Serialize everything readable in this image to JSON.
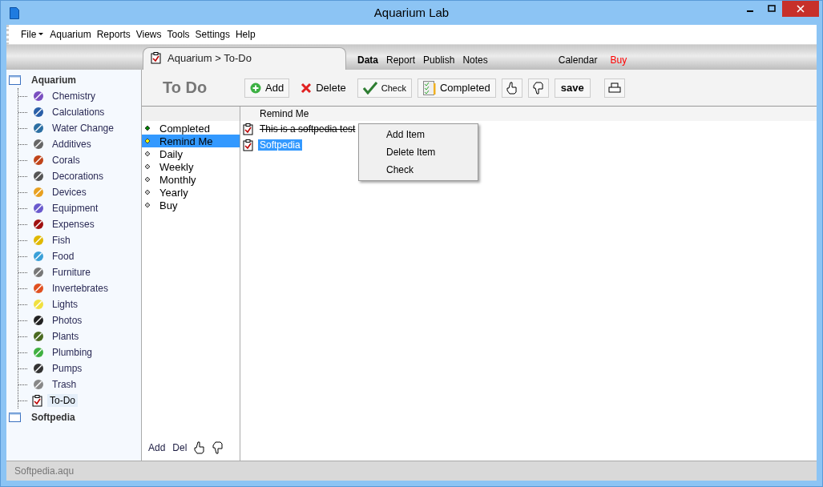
{
  "window": {
    "title": "Aquarium Lab"
  },
  "menu": [
    "File",
    "Aquarium",
    "Reports",
    "Views",
    "Tools",
    "Settings",
    "Help"
  ],
  "tab": {
    "label": "Aquarium > To-Do"
  },
  "nav": [
    {
      "label": "Data",
      "selected": true,
      "color": "#000000"
    },
    {
      "label": "Report",
      "selected": false,
      "color": "#000000"
    },
    {
      "label": "Publish",
      "selected": false,
      "color": "#000000"
    },
    {
      "label": "Notes",
      "selected": false,
      "color": "#000000"
    },
    {
      "label": "Calendar",
      "selected": false,
      "color": "#000000"
    },
    {
      "label": "Buy",
      "selected": false,
      "color": "#ff0000"
    }
  ],
  "sidebar": {
    "items": [
      {
        "label": "Aquarium",
        "children": [
          {
            "label": "Chemistry",
            "selected": false
          },
          {
            "label": "Calculations",
            "selected": false
          },
          {
            "label": "Water Change",
            "selected": false
          },
          {
            "label": "Additives",
            "selected": false
          },
          {
            "label": "Corals",
            "selected": false
          },
          {
            "label": "Decorations",
            "selected": false
          },
          {
            "label": "Devices",
            "selected": false
          },
          {
            "label": "Equipment",
            "selected": false
          },
          {
            "label": "Expenses",
            "selected": false
          },
          {
            "label": "Fish",
            "selected": false
          },
          {
            "label": "Food",
            "selected": false
          },
          {
            "label": "Furniture",
            "selected": false
          },
          {
            "label": "Invertebrates",
            "selected": false
          },
          {
            "label": "Lights",
            "selected": false
          },
          {
            "label": "Photos",
            "selected": false
          },
          {
            "label": "Plants",
            "selected": false
          },
          {
            "label": "Plumbing",
            "selected": false
          },
          {
            "label": "Pumps",
            "selected": false
          },
          {
            "label": "Trash",
            "selected": false
          },
          {
            "label": "To-Do",
            "selected": true
          }
        ]
      },
      {
        "label": "Softpedia"
      }
    ]
  },
  "page_title": "To Do",
  "toolbar": [
    {
      "kind": "add",
      "label": "Add"
    },
    {
      "kind": "delete",
      "label": "Delete"
    },
    {
      "kind": "check",
      "label": "Check"
    },
    {
      "kind": "completed",
      "label": "Completed"
    },
    {
      "kind": "up"
    },
    {
      "kind": "down"
    },
    {
      "kind": "save",
      "label": "save"
    },
    {
      "kind": "print"
    }
  ],
  "categories": [
    {
      "label": "Completed",
      "selected": false,
      "color": "#008000"
    },
    {
      "label": "Remind Me",
      "selected": true,
      "color": "#ffff00"
    },
    {
      "label": "Daily",
      "selected": false,
      "color": "#c0c0c0"
    },
    {
      "label": "Weekly",
      "selected": false,
      "color": "#c0c0c0"
    },
    {
      "label": "Monthly",
      "selected": false,
      "color": "#c0c0c0"
    },
    {
      "label": "Yearly",
      "selected": false,
      "color": "#c0c0c0"
    },
    {
      "label": "Buy",
      "selected": false,
      "color": "#c0c0c0"
    }
  ],
  "category_actions": [
    {
      "kind": "text",
      "label": "Add"
    },
    {
      "kind": "text",
      "label": "Del"
    },
    {
      "kind": "up"
    },
    {
      "kind": "down"
    }
  ],
  "list": {
    "header": "Remind Me",
    "items": [
      {
        "text": "This is a softpedia test",
        "completed": true,
        "selected": false
      },
      {
        "text": "Softpedia",
        "completed": false,
        "selected": true
      }
    ]
  },
  "context_menu": [
    "Add Item",
    "Delete Item",
    "Check"
  ],
  "status_bar": "Softpedia.aqu"
}
